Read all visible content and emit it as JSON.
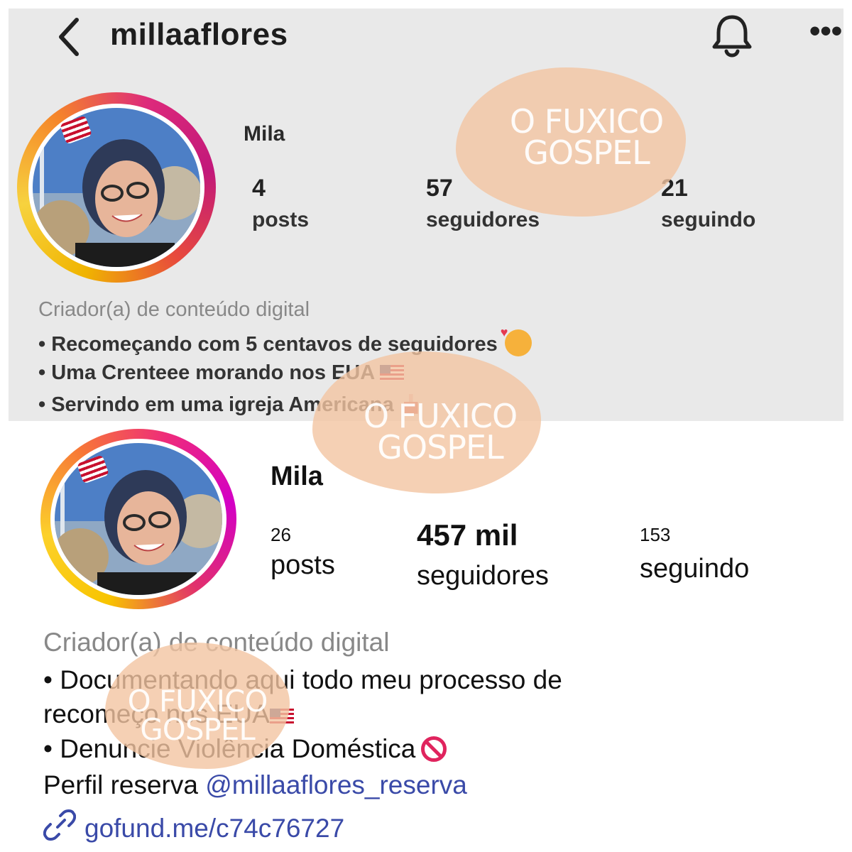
{
  "old_profile": {
    "header": {
      "username": "millaaflores",
      "back_icon": "chevron-left-icon",
      "bell_icon": "bell-icon",
      "more_label": "•••"
    },
    "name": "Mila",
    "stats": [
      {
        "value": "4",
        "label": "posts"
      },
      {
        "value": "57",
        "label": "seguidores"
      },
      {
        "value": "21",
        "label": "seguindo"
      }
    ],
    "category": "Criador(a) de conteúdo digital",
    "bio": [
      "• Recomeçando com 5 centavos de seguidores",
      "• Uma Crenteee morando nos EUA",
      "• Servindo em uma igreja Americana"
    ]
  },
  "new_profile": {
    "name": "Mila",
    "stats": [
      {
        "value": "26",
        "label": "posts"
      },
      {
        "value": "457 mil",
        "label": "seguidores"
      },
      {
        "value": "153",
        "label": "seguindo"
      }
    ],
    "category": "Criador(a) de conteúdo digital",
    "bio": [
      "• Documentando aqui todo meu processo de",
      "recomeço nos EUA",
      "• Denuncie Violência Doméstica"
    ],
    "backup_prefix": "Perfil reserva ",
    "backup_handle": "@millaaflores_reserva",
    "link": "gofund.me/c74c76727"
  },
  "watermark": {
    "line1": "O FUXICO",
    "line2": "GOSPEL",
    "color": "#f3c4a1"
  }
}
